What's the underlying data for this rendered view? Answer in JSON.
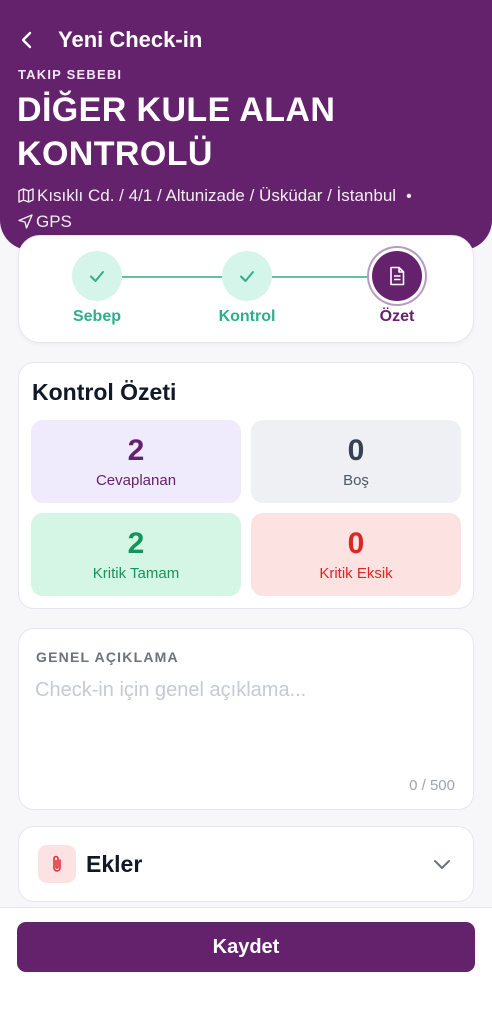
{
  "header": {
    "title": "Yeni Check-in",
    "reason_label": "TAKIP SEBEBI",
    "reason_title": "DİĞER KULE ALAN KONTROLÜ",
    "address": "Kısıklı Cd. / 4/1 / Altunizade / Üsküdar / İstanbul",
    "location_source": "GPS"
  },
  "stepper": {
    "steps": [
      {
        "label": "Sebep",
        "state": "done",
        "icon": "check-icon"
      },
      {
        "label": "Kontrol",
        "state": "done",
        "icon": "check-icon"
      },
      {
        "label": "Özet",
        "state": "active",
        "icon": "document-icon"
      }
    ]
  },
  "summary": {
    "title": "Kontrol Özeti",
    "stats": [
      {
        "value": "2",
        "label": "Cevaplanan",
        "bg": "#efeafc",
        "value_color": "#65226c",
        "label_color": "#65226c"
      },
      {
        "value": "0",
        "label": "Boş",
        "bg": "#eef0f4",
        "value_color": "#374151",
        "label_color": "#4b5563"
      },
      {
        "value": "2",
        "label": "Kritik Tamam",
        "bg": "#d5f6e4",
        "value_color": "#15935f",
        "label_color": "#15935f"
      },
      {
        "value": "0",
        "label": "Kritik Eksik",
        "bg": "#fde2e2",
        "value_color": "#dc2626",
        "label_color": "#dc2626"
      }
    ]
  },
  "description": {
    "label": "GENEL AÇIKLAMA",
    "placeholder": "Check-in için genel açıklama...",
    "value": "",
    "char_count": "0 / 500"
  },
  "attachments": {
    "title": "Ekler",
    "icon": "paperclip-icon"
  },
  "actions": {
    "save_label": "Kaydet"
  },
  "colors": {
    "brand": "#65226c",
    "success": "#2fae8a",
    "danger": "#dc2626"
  }
}
